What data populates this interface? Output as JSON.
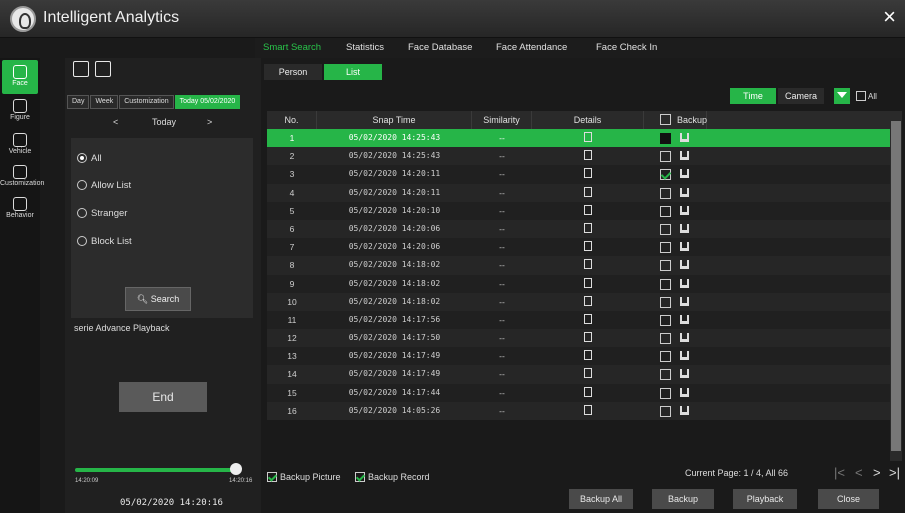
{
  "title": "Intelligent Analytics",
  "close_icon": "×",
  "topnav": [
    "Smart Search",
    "Statistics",
    "Face Database",
    "Face Attendance",
    "Face Check In"
  ],
  "sidebar": [
    "Face",
    "Figure",
    "Vehicle",
    "Customization",
    "Behavior"
  ],
  "filter": {
    "tabs": [
      "Day",
      "Week",
      "Customization",
      "Today 05/02/2020"
    ],
    "prev": "<",
    "next": ">",
    "day_label": "Today",
    "radios": [
      "All",
      "Allow List",
      "Stranger",
      "Block List"
    ],
    "search": "Search",
    "desc": "serie Advance Playback",
    "end": "End",
    "slider_start": "14:20:09",
    "slider_end": "14:20:16",
    "slider_level": 0.97,
    "current_time": "05/02/2020 14:20:16"
  },
  "list_tabs": [
    "Person",
    "List"
  ],
  "sort": [
    "Time",
    "Camera",
    "All"
  ],
  "table": {
    "headers": [
      "No.",
      "Snap Time",
      "Similarity",
      "Details",
      "Backup"
    ],
    "rows": [
      {
        "no": "1",
        "time": "05/02/2020 14:25:43",
        "sim": "--"
      },
      {
        "no": "2",
        "time": "05/02/2020 14:25:43",
        "sim": "--"
      },
      {
        "no": "3",
        "time": "05/02/2020 14:20:11",
        "sim": "--"
      },
      {
        "no": "4",
        "time": "05/02/2020 14:20:11",
        "sim": "--"
      },
      {
        "no": "5",
        "time": "05/02/2020 14:20:10",
        "sim": "--"
      },
      {
        "no": "6",
        "time": "05/02/2020 14:20:06",
        "sim": "--"
      },
      {
        "no": "7",
        "time": "05/02/2020 14:20:06",
        "sim": "--"
      },
      {
        "no": "8",
        "time": "05/02/2020 14:18:02",
        "sim": "--"
      },
      {
        "no": "9",
        "time": "05/02/2020 14:18:02",
        "sim": "--"
      },
      {
        "no": "10",
        "time": "05/02/2020 14:18:02",
        "sim": "--"
      },
      {
        "no": "11",
        "time": "05/02/2020 14:17:56",
        "sim": "--"
      },
      {
        "no": "12",
        "time": "05/02/2020 14:17:50",
        "sim": "--"
      },
      {
        "no": "13",
        "time": "05/02/2020 14:17:49",
        "sim": "--"
      },
      {
        "no": "14",
        "time": "05/02/2020 14:17:49",
        "sim": "--"
      },
      {
        "no": "15",
        "time": "05/02/2020 14:17:44",
        "sim": "--"
      },
      {
        "no": "16",
        "time": "05/02/2020 14:05:26",
        "sim": "--"
      }
    ]
  },
  "footer": {
    "backup_picture": "Backup Picture",
    "backup_record": "Backup Record",
    "page_info": "Current Page: 1 / 4, All 66",
    "buttons": [
      "Backup All",
      "Backup",
      "Playback",
      "Close"
    ]
  }
}
